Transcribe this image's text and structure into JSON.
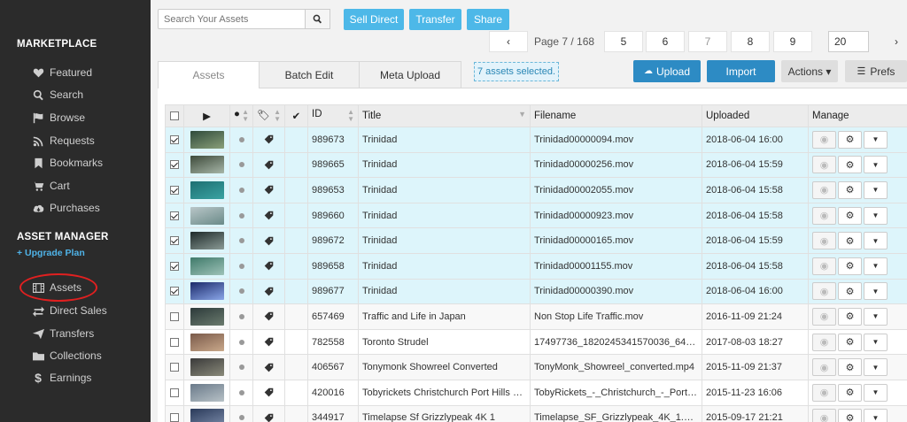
{
  "sidebar": {
    "marketplace_heading": "MARKETPLACE",
    "marketplace_items": [
      {
        "label": "Featured",
        "icon": "heart-icon"
      },
      {
        "label": "Search",
        "icon": "search-icon"
      },
      {
        "label": "Browse",
        "icon": "flag-icon"
      },
      {
        "label": "Requests",
        "icon": "rss-icon"
      },
      {
        "label": "Bookmarks",
        "icon": "bookmark-icon"
      },
      {
        "label": "Cart",
        "icon": "cart-icon"
      },
      {
        "label": "Purchases",
        "icon": "cloud-download-icon"
      }
    ],
    "asset_manager_heading": "ASSET MANAGER",
    "upgrade_label": "+ Upgrade Plan",
    "asset_items": [
      {
        "label": "Assets",
        "icon": "film-icon"
      },
      {
        "label": "Direct Sales",
        "icon": "exchange-icon"
      },
      {
        "label": "Transfers",
        "icon": "send-icon"
      },
      {
        "label": "Collections",
        "icon": "folder-icon"
      },
      {
        "label": "Earnings",
        "icon": "dollar-icon"
      }
    ]
  },
  "toolbar": {
    "search_placeholder": "Search Your Assets",
    "sell_direct": "Sell Direct",
    "transfer": "Transfer",
    "share": "Share"
  },
  "pagination": {
    "prev": "‹",
    "label": "Page 7 / 168",
    "pages": [
      "5",
      "6",
      "7",
      "8",
      "9"
    ],
    "current": "7",
    "per_page": "20",
    "next": "›"
  },
  "tabs": [
    "Assets",
    "Batch Edit",
    "Meta Upload"
  ],
  "selection_text": "7 assets selected.",
  "actions": {
    "upload": "Upload",
    "import": "Import",
    "actions": "Actions ▾",
    "prefs": "Prefs"
  },
  "table": {
    "headers": {
      "id": "ID",
      "title": "Title",
      "filename": "Filename",
      "uploaded": "Uploaded",
      "manage": "Manage"
    },
    "rows": [
      {
        "selected": true,
        "id": "989673",
        "title": "Trinidad",
        "filename": "Trinidad00000094.mov",
        "uploaded": "2018-06-04 16:00",
        "thumb": [
          "#2f4a3a",
          "#8aa07a"
        ]
      },
      {
        "selected": true,
        "id": "989665",
        "title": "Trinidad",
        "filename": "Trinidad00000256.mov",
        "uploaded": "2018-06-04 15:59",
        "thumb": [
          "#3d4a3a",
          "#a7b6a8"
        ]
      },
      {
        "selected": true,
        "id": "989653",
        "title": "Trinidad",
        "filename": "Trinidad00002055.mov",
        "uploaded": "2018-06-04 15:58",
        "thumb": [
          "#1e6f72",
          "#3aa3a2"
        ]
      },
      {
        "selected": true,
        "id": "989660",
        "title": "Trinidad",
        "filename": "Trinidad00000923.mov",
        "uploaded": "2018-06-04 15:58",
        "thumb": [
          "#b9c6c8",
          "#6a8a88"
        ]
      },
      {
        "selected": true,
        "id": "989672",
        "title": "Trinidad",
        "filename": "Trinidad00000165.mov",
        "uploaded": "2018-06-04 15:59",
        "thumb": [
          "#1e2a2a",
          "#8a9a95"
        ]
      },
      {
        "selected": true,
        "id": "989658",
        "title": "Trinidad",
        "filename": "Trinidad00001155.mov",
        "uploaded": "2018-06-04 15:58",
        "thumb": [
          "#3f7a6a",
          "#9ec2b8"
        ]
      },
      {
        "selected": true,
        "id": "989677",
        "title": "Trinidad",
        "filename": "Trinidad00000390.mov",
        "uploaded": "2018-06-04 16:00",
        "thumb": [
          "#1b2a6a",
          "#8aa6e8"
        ]
      },
      {
        "selected": false,
        "id": "657469",
        "title": "Traffic and Life in Japan",
        "filename": "Non Stop Life Traffic.mov",
        "uploaded": "2016-11-09 21:24",
        "thumb": [
          "#2c3a3a",
          "#6b7b6e"
        ]
      },
      {
        "selected": false,
        "id": "782558",
        "title": "Toronto Strudel",
        "filename": "17497736_1820245341570036_6452...",
        "uploaded": "2017-08-03 18:27",
        "thumb": [
          "#7a5a4a",
          "#c9a88a"
        ]
      },
      {
        "selected": false,
        "id": "406567",
        "title": "Tonymonk Showreel Converted",
        "filename": "TonyMonk_Showreel_converted.mp4",
        "uploaded": "2015-11-09 21:37",
        "thumb": [
          "#3a3a3a",
          "#8a8a7a"
        ]
      },
      {
        "selected": false,
        "id": "420016",
        "title": "Tobyrickets Christchurch Port Hills Flyo...",
        "filename": "TobyRickets_-_Christchurch_-_Port_Hill...",
        "uploaded": "2015-11-23 16:06",
        "thumb": [
          "#6a7a8a",
          "#b7c1c6"
        ]
      },
      {
        "selected": false,
        "id": "344917",
        "title": "Timelapse Sf Grizzlypeak 4K 1",
        "filename": "Timelapse_SF_Grizzlypeak_4K_1.mov",
        "uploaded": "2015-09-17 21:21",
        "thumb": [
          "#2a3a5a",
          "#7a8aa8"
        ]
      }
    ]
  }
}
